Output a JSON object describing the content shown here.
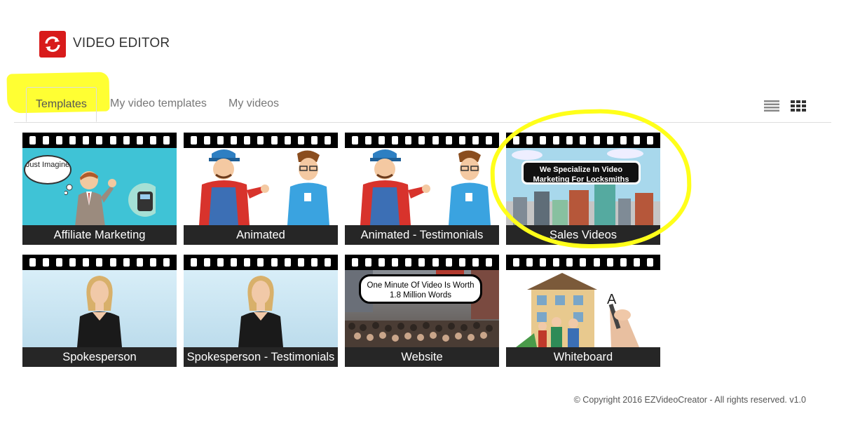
{
  "app": {
    "title": "VIDEO EDITOR",
    "logo_icon": "refresh-icon",
    "brand_color": "#d81b1b"
  },
  "tabs": [
    {
      "label": "Templates",
      "active": true
    },
    {
      "label": "My video templates",
      "active": false
    },
    {
      "label": "My videos",
      "active": false
    }
  ],
  "view_toggle": {
    "list_icon": "list-view-icon",
    "grid_icon": "grid-view-icon",
    "selected": "grid"
  },
  "templates": [
    {
      "label": "Affiliate Marketing",
      "thumb_text": "Just Imagine"
    },
    {
      "label": "Animated"
    },
    {
      "label": "Animated - Testimonials"
    },
    {
      "label": "Sales Videos",
      "thumb_text": "We Specialize In Video Marketing For Locksmiths",
      "highlighted": true
    },
    {
      "label": "Spokesperson"
    },
    {
      "label": "Spokesperson - Testimonials"
    },
    {
      "label": "Website",
      "thumb_text": "One Minute Of Video Is Worth 1.8 Million Words"
    },
    {
      "label": "Whiteboard",
      "thumb_text": "A"
    }
  ],
  "highlight_color": "#ffff33",
  "footer": {
    "copyright": "© Copyright 2016 EZVideoCreator - All rights reserved. v1.0"
  }
}
